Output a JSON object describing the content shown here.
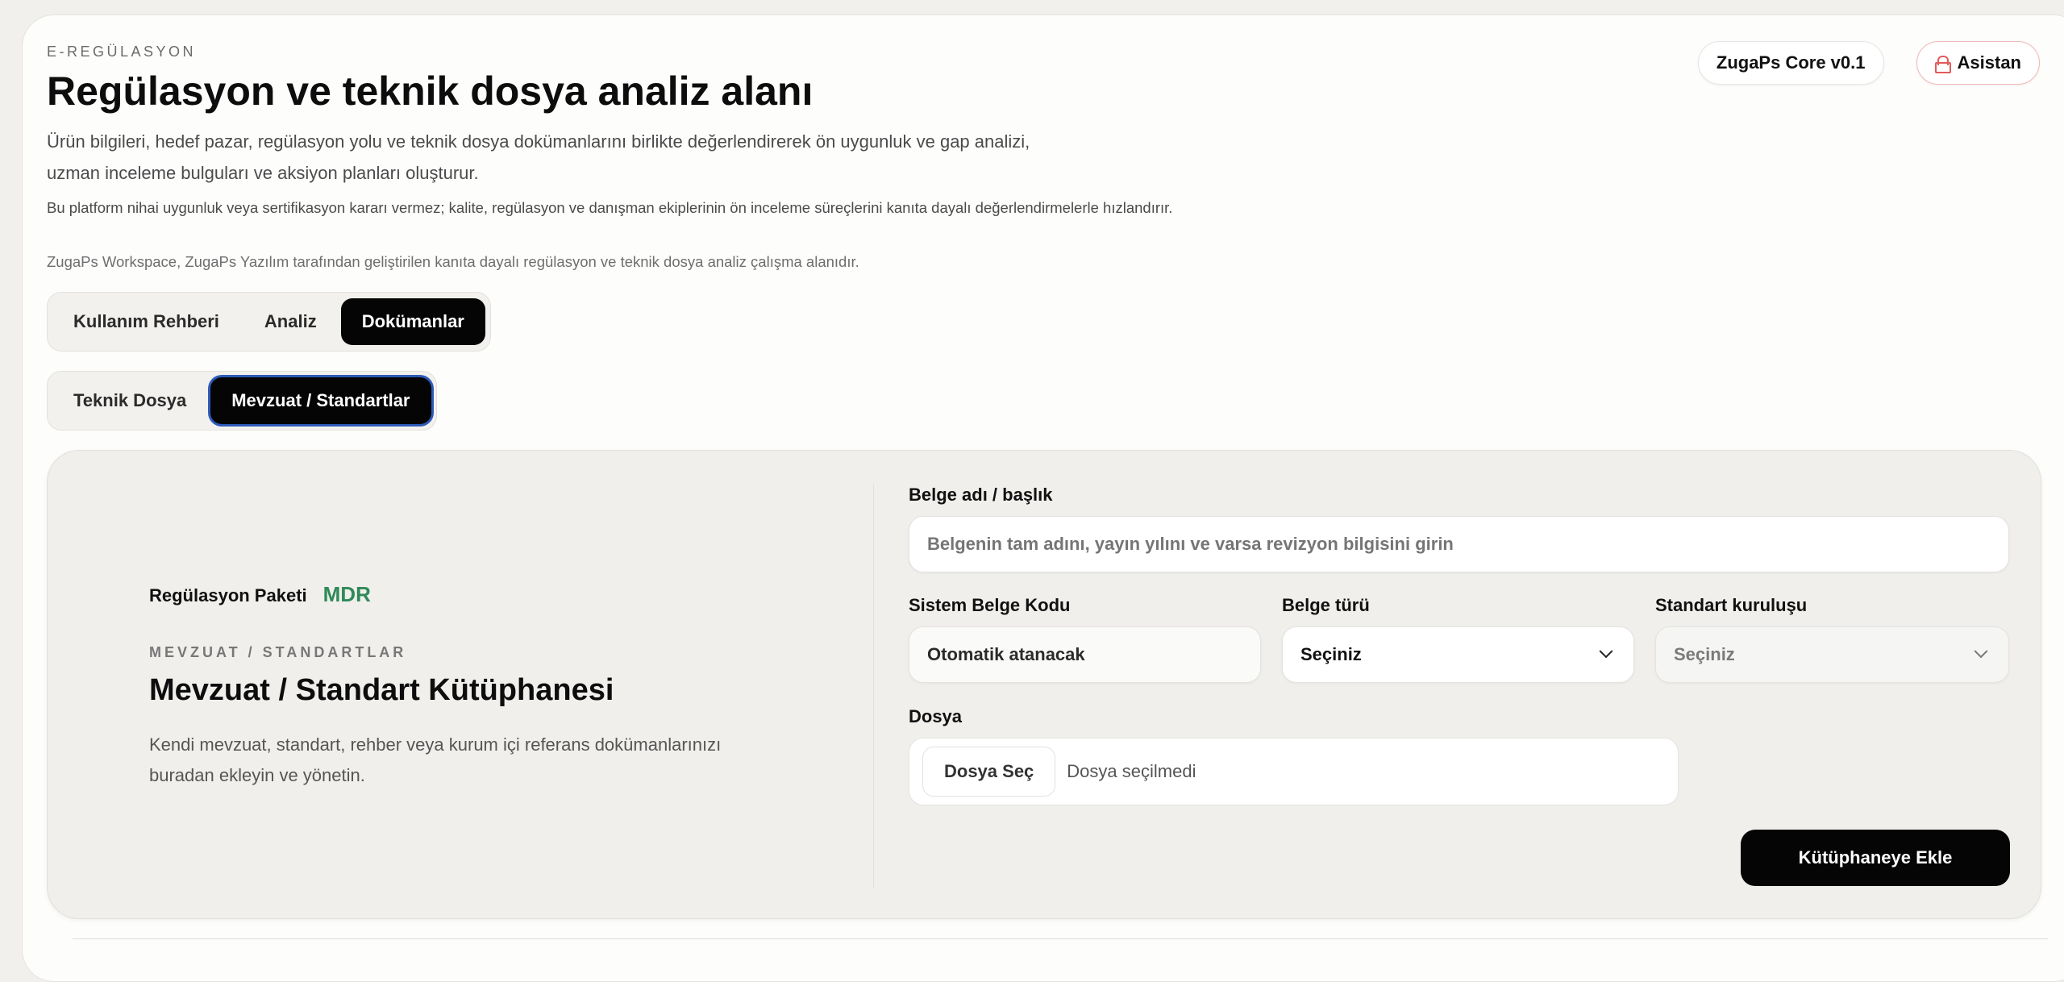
{
  "header": {
    "eyebrow": "E-REGÜLASYON",
    "title": "Regülasyon ve teknik dosya analiz alanı",
    "description": "Ürün bilgileri, hedef pazar, regülasyon yolu ve teknik dosya dokümanlarını birlikte değerlendirerek ön uygunluk ve gap analizi, uzman inceleme bulguları ve aksiyon planları oluşturur.",
    "note": "Bu platform nihai uygunluk veya sertifikasyon kararı vermez; kalite, regülasyon ve danışman ekiplerinin ön inceleme süreçlerini kanıta dayalı değerlendirmelerle hızlandırır.",
    "credit": "ZugaPs Workspace, ZugaPs Yazılım tarafından geliştirilen kanıta dayalı regülasyon ve teknik dosya analiz çalışma alanıdır.",
    "version_label": "ZugaPs Core v0.1",
    "assistant_label": "Asistan",
    "assistant_icon": "lock-icon",
    "accent_color": "#e25a5a"
  },
  "main_tabs": [
    {
      "label": "Kullanım Rehberi",
      "active": false
    },
    {
      "label": "Analiz",
      "active": false
    },
    {
      "label": "Dokümanlar",
      "active": true
    }
  ],
  "sub_tabs": [
    {
      "label": "Teknik Dosya",
      "active": false
    },
    {
      "label": "Mevzuat / Standartlar",
      "active": true
    }
  ],
  "library": {
    "package_label": "Regülasyon Paketi",
    "package_value": "MDR",
    "package_color": "#2f8a58",
    "eyebrow": "MEVZUAT / STANDARTLAR",
    "title": "Mevzuat / Standart Kütüphanesi",
    "description": "Kendi mevzuat, standart, rehber veya kurum içi referans dokümanlarınızı buradan ekleyin ve yönetin."
  },
  "form": {
    "doc_name_label": "Belge adı / başlık",
    "doc_name_placeholder": "Belgenin tam adını, yayın yılını ve varsa revizyon bilgisini girin",
    "system_code_label": "Sistem Belge Kodu",
    "system_code_value": "Otomatik atanacak",
    "doc_type_label": "Belge türü",
    "doc_type_value": "Seçiniz",
    "standard_org_label": "Standart kuruluşu",
    "standard_org_value": "Seçiniz",
    "file_label": "Dosya",
    "file_button": "Dosya Seç",
    "file_status": "Dosya seçilmedi",
    "submit_label": "Kütüphaneye Ekle"
  }
}
